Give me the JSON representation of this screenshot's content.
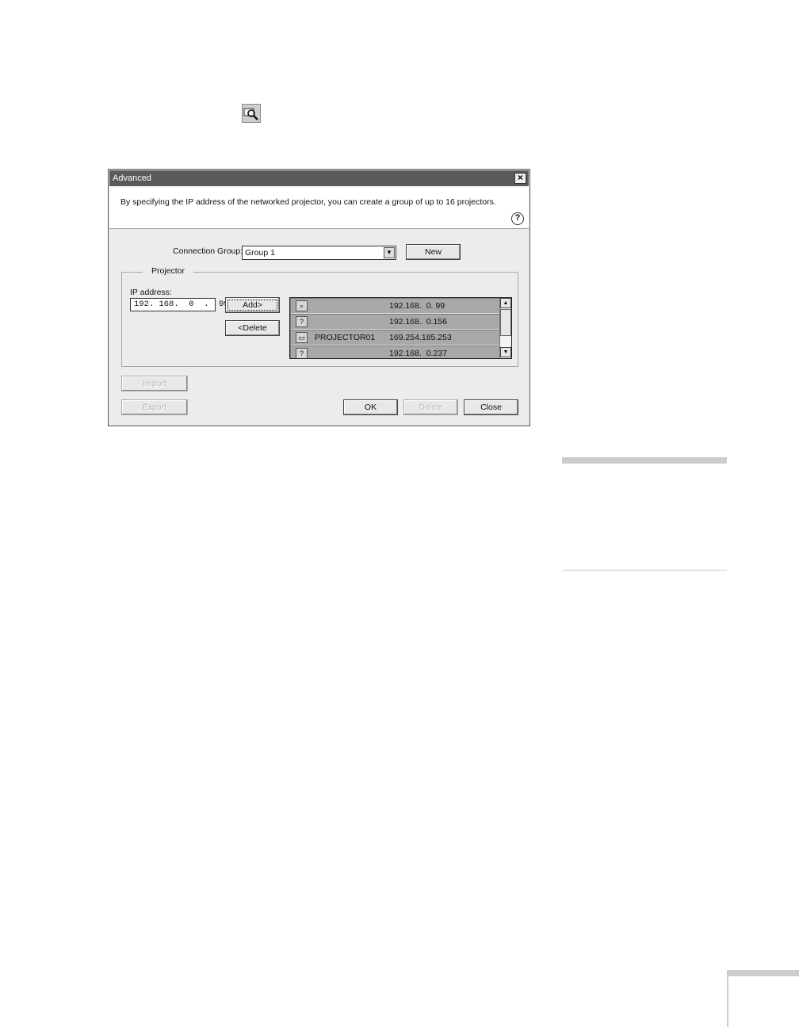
{
  "dialog": {
    "title": "Advanced",
    "close_glyph": "×",
    "description": "By specifying the IP address of the networked projector, you can create a group of up to 16 projectors.",
    "help_glyph": "?"
  },
  "connection_group": {
    "label": "Connection Group:",
    "selected": "Group 1",
    "new_label": "New"
  },
  "projector": {
    "legend": "Projector",
    "ip_label": "IP address:",
    "ip_value": "192. 168.  0  .  99",
    "add_label": "Add>",
    "delete_label": "<Delete",
    "list": [
      {
        "icon": "search-projector-icon",
        "name": "",
        "address": "192.168.  0. 99"
      },
      {
        "icon": "unknown-projector-icon",
        "name": "",
        "address": "192.168.  0.156"
      },
      {
        "icon": "projector-icon",
        "name": "PROJECTOR01",
        "address": "169.254.185.253"
      },
      {
        "icon": "unknown-projector-icon",
        "name": "",
        "address": "192.168.  0.237"
      }
    ]
  },
  "footer": {
    "import_label": "Import",
    "export_label": "Export",
    "ok_label": "OK",
    "delete_label": "Delete",
    "close_label": "Close"
  }
}
